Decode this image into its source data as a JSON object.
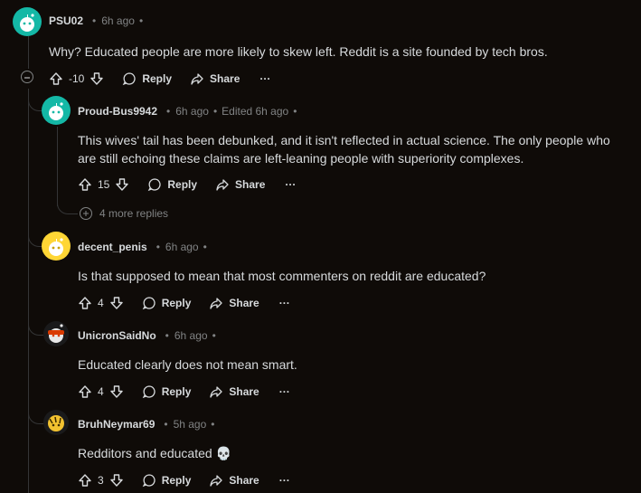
{
  "comments": [
    {
      "user": "PSU02",
      "time": "6h ago",
      "edited": "",
      "body": "Why? Educated people are more likely to skew left. Reddit is a site founded by tech bros.",
      "score": "-10"
    },
    {
      "user": "Proud-Bus9942",
      "time": "6h ago",
      "edited": "Edited 6h ago",
      "body": "This wives' tail has been debunked, and it isn't reflected in actual science. The only people who are still echoing these claims are left-leaning people with superiority complexes.",
      "score": "15"
    },
    {
      "user": "decent_penis",
      "time": "6h ago",
      "edited": "",
      "body": "Is that supposed to mean that most commenters on reddit are educated?",
      "score": "4"
    },
    {
      "user": "UnicronSaidNo",
      "time": "6h ago",
      "edited": "",
      "body": "Educated clearly does not mean smart.",
      "score": "4"
    },
    {
      "user": "BruhNeymar69",
      "time": "5h ago",
      "edited": "",
      "body": "Redditors and educated 💀",
      "score": "3"
    }
  ],
  "labels": {
    "reply": "Reply",
    "share": "Share",
    "more": "···",
    "sep": "•"
  },
  "more_replies": "4 more replies",
  "colors": {
    "bg": "#0f0b08",
    "text": "#d7dadc",
    "muted": "#818384",
    "teal": "#14b8a6",
    "yellow": "#ffd635"
  }
}
